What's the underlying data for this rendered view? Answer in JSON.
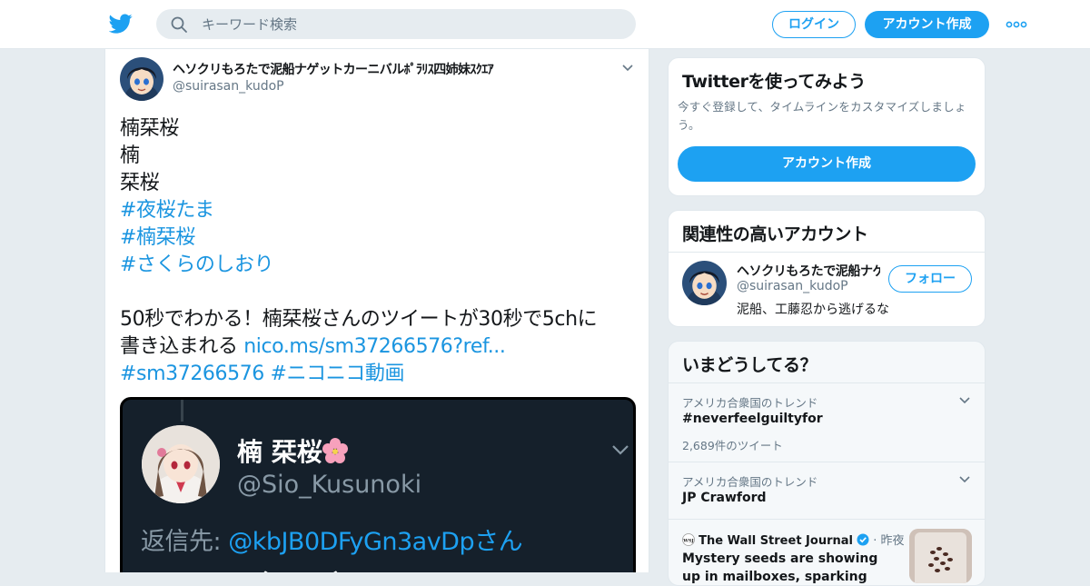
{
  "header": {
    "search_placeholder": "キーワード検索",
    "login_label": "ログイン",
    "signup_label": "アカウント作成"
  },
  "tweet": {
    "display_name": "ヘソクリもろたで泥船ナゲットカーニバルﾎﾟﾗﾘｽ四姉妹ｽｸｴｱ",
    "handle": "@suirasan_kudoP",
    "lines": [
      "楠栞桜",
      "楠",
      "栞桜"
    ],
    "hashtags": [
      "#夜桜たま",
      "#楠栞桜",
      "#さくらのしおり"
    ],
    "body_line1": "50秒でわかる！楠栞桜さんのツイートが30秒で5chに",
    "body_line2_text": "書き込まれる ",
    "body_link": "nico.ms/sm37266576?ref...",
    "body_tag1": "#sm37266576",
    "body_tag2": "#ニコニコ動画",
    "media": {
      "name": "楠 栞桜",
      "handle": "@Sio_Kusunoki",
      "reply_prefix": "返信先: ",
      "reply_handle": "@kbJB0DFyGn3avDpさん",
      "bottom_text": "いらね〜（ ˘ω˘ ）"
    }
  },
  "signup_card": {
    "title": "Twitterを使ってみよう",
    "subtitle": "今すぐ登録して、タイムラインをカスタマイズしましょう。",
    "button": "アカウント作成"
  },
  "related_card": {
    "title": "関連性の高いアカウント",
    "name": "ヘソクリもろたで泥船ナゲットカーニバル",
    "handle": "@suirasan_kudoP",
    "bio": "泥船、工藤忍から逃げるな",
    "follow_label": "フォロー"
  },
  "trends_card": {
    "title": "いまどうしてる？",
    "trends": [
      {
        "meta": "アメリカ合衆国のトレンド",
        "name": "#neverfeelguiltyfor",
        "count": "2,689件のツイート"
      },
      {
        "meta": "アメリカ合衆国のトレンド",
        "name": "JP Crawford",
        "count": ""
      }
    ],
    "news": {
      "source": "The Wall Street Journal",
      "time": "昨夜",
      "headline": "Mystery seeds are showing up in mailboxes, sparking investigations"
    }
  },
  "colors": {
    "accent": "#1da1f2",
    "link": "#1b95e0",
    "background": "#e6ecf0"
  }
}
